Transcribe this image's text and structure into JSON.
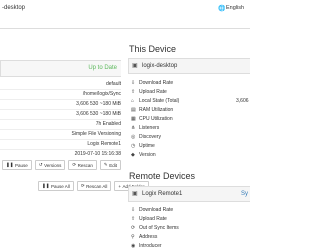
{
  "topbar": {
    "device_name": "-desktop",
    "language": "English"
  },
  "left": {
    "status": "Up to Date",
    "rows": [
      {
        "value": "default"
      },
      {
        "value": "/home/logix/Sync"
      },
      {
        "value": "3,606  530  ~180 MiB"
      },
      {
        "value": "3,606  530  ~180 MiB"
      },
      {
        "value": "7h  Enabled"
      },
      {
        "value": "Simple File Versioning"
      },
      {
        "value": "Logix Remote1"
      },
      {
        "value": "2019-07-10 15:16:38"
      }
    ],
    "buttons": {
      "pause": "Pause",
      "versions": "Versions",
      "rescan": "Rescan",
      "edit": "Edit",
      "pause_all": "Pause All",
      "rescan_all": "Rescan All",
      "add_folder": "Add Folder"
    }
  },
  "this_device": {
    "heading": "This Device",
    "name": "logix-desktop",
    "stats": [
      "Download Rate",
      "Upload Rate",
      "Local State (Total)",
      "RAM Utilization",
      "CPU Utilization",
      "Listeners",
      "Discovery",
      "Uptime",
      "Version"
    ],
    "local_state_value": "3,606"
  },
  "remote_devices": {
    "heading": "Remote Devices",
    "name": "Logix Remote1",
    "status": "Sy",
    "stats": [
      "Download Rate",
      "Upload Rate",
      "Out of Sync Items",
      "Address",
      "Introducer"
    ]
  },
  "colors": {
    "ok": "#5cb85c",
    "link": "#337ab7",
    "border": "#dddddd"
  }
}
